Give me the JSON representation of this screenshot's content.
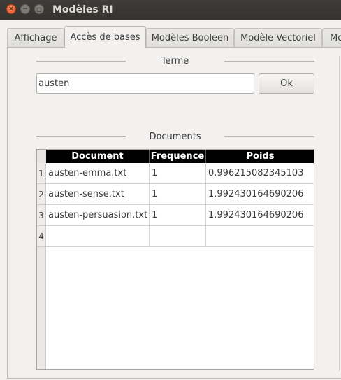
{
  "window": {
    "title": "Modèles RI",
    "close_glyph": "×",
    "min_glyph": "−",
    "max_glyph": "□"
  },
  "tabs": [
    {
      "label": "Affichage"
    },
    {
      "label": "Accès de bases",
      "active": true
    },
    {
      "label": "Modèles Booleen"
    },
    {
      "label": "Modèle Vectoriel"
    },
    {
      "label": "Mo"
    }
  ],
  "terme": {
    "group_title": "Terme",
    "input_value": "austen",
    "ok_label": "Ok"
  },
  "documents": {
    "group_title": "Documents",
    "columns": [
      "Document",
      "Frequence",
      "Poids"
    ],
    "row_headers": [
      "1",
      "2",
      "3",
      "4"
    ],
    "rows": [
      [
        "austen-emma.txt",
        "1",
        "0.996215082345103"
      ],
      [
        "austen-sense.txt",
        "1",
        "1.992430164690206"
      ],
      [
        "austen-persuasion.txt",
        "1",
        "1.992430164690206"
      ],
      [
        "",
        "",
        ""
      ]
    ]
  },
  "colors": {
    "titlebar": "#3c3b37",
    "close_button": "#e95420",
    "table_header": "#000000"
  },
  "icons": {
    "close": "close-icon",
    "minimize": "minimize-icon",
    "maximize": "maximize-icon"
  }
}
